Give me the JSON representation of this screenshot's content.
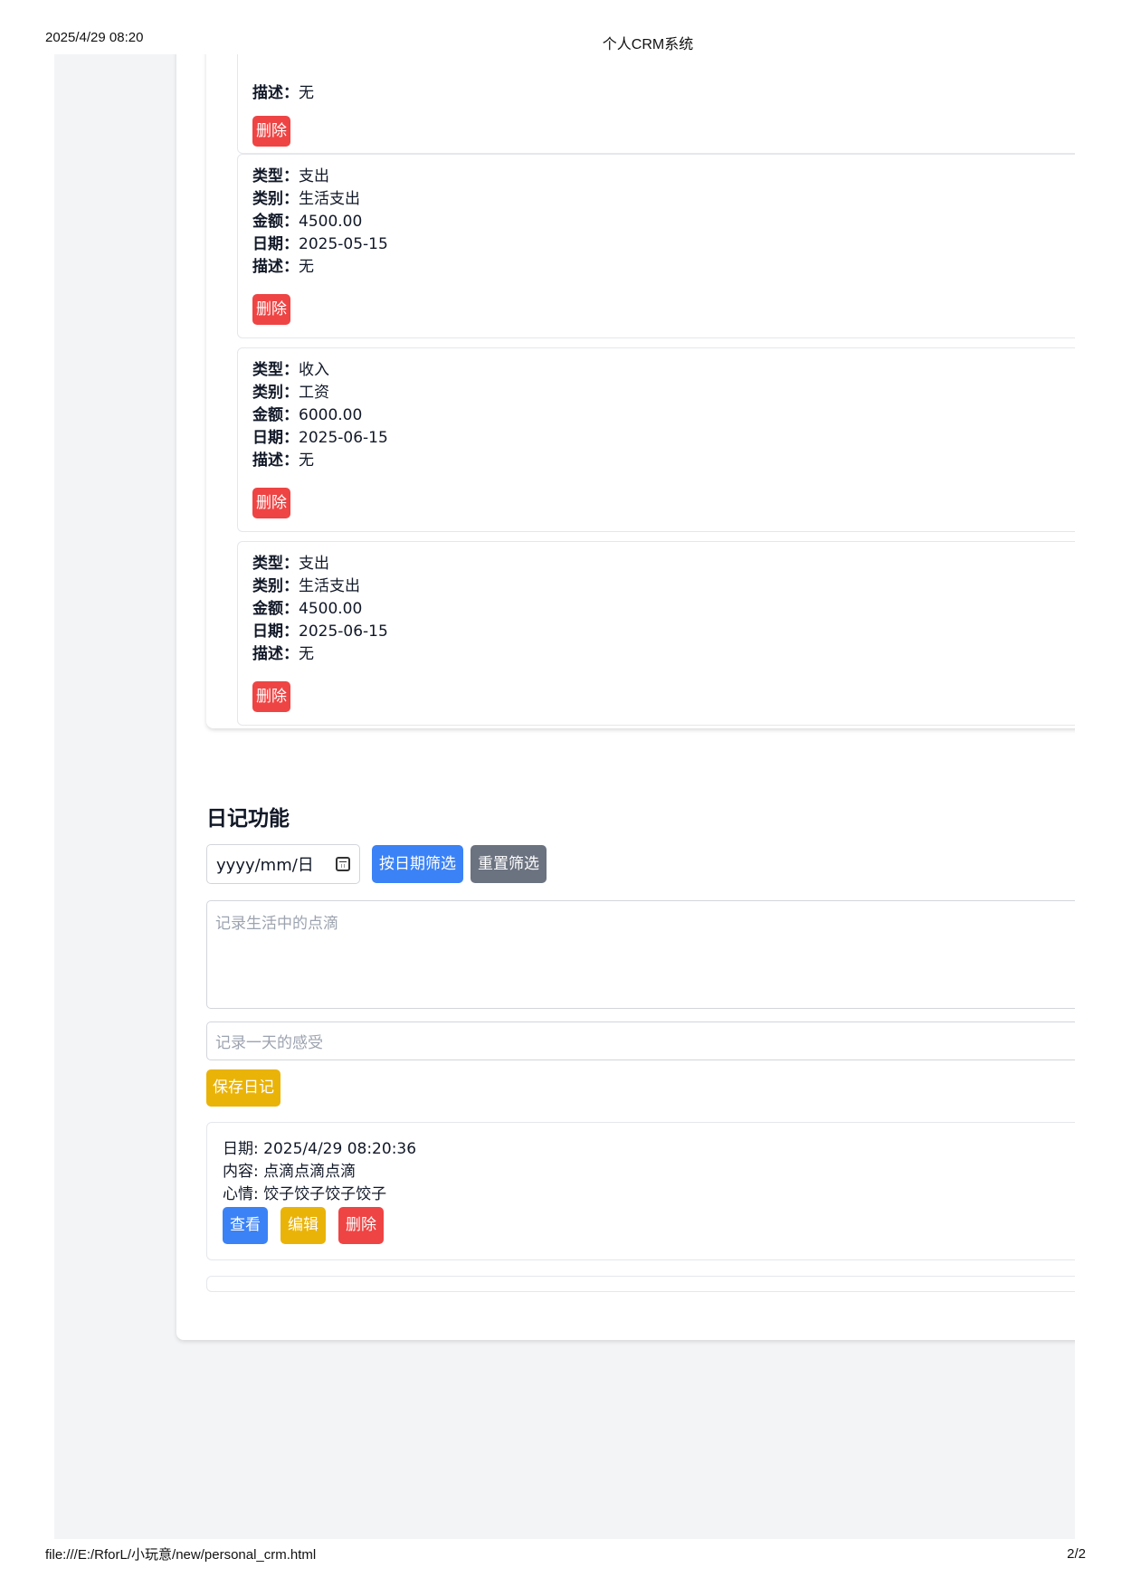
{
  "print": {
    "datetime": "2025/4/29 08:20",
    "title": "个人CRM系统",
    "url": "file:///E:/RforL/小玩意/new/personal_crm.html",
    "page": "2/2"
  },
  "finance": {
    "labels": {
      "type": "类型：",
      "category": "类别：",
      "amount": "金额：",
      "date": "日期：",
      "description": "描述："
    },
    "delete_label": "删除",
    "partial_record": {
      "description": "无"
    },
    "records": [
      {
        "type": "支出",
        "category": "生活支出",
        "amount": "4500.00",
        "date": "2025-05-15",
        "description": "无"
      },
      {
        "type": "收入",
        "category": "工资",
        "amount": "6000.00",
        "date": "2025-06-15",
        "description": "无"
      },
      {
        "type": "支出",
        "category": "生活支出",
        "amount": "4500.00",
        "date": "2025-06-15",
        "description": "无"
      }
    ]
  },
  "diary": {
    "title": "日记功能",
    "date_placeholder": "yyyy/mm/日",
    "filter_label": "按日期筛选",
    "reset_label": "重置筛选",
    "content_placeholder": "记录生活中的点滴",
    "mood_placeholder": "记录一天的感受",
    "save_label": "保存日记",
    "entries": [
      {
        "date_line": "日期: 2025/4/29 08:20:36",
        "content_line": "内容: 点滴点滴点滴",
        "mood_line": "心情: 饺子饺子饺子饺子",
        "view_label": "查看",
        "edit_label": "编辑",
        "delete_label": "删除"
      }
    ]
  },
  "colors": {
    "danger": "#ef4444",
    "primary": "#3b82f6",
    "secondary": "#6b7280",
    "warning": "#eab308",
    "page_bg": "#f3f4f6"
  }
}
